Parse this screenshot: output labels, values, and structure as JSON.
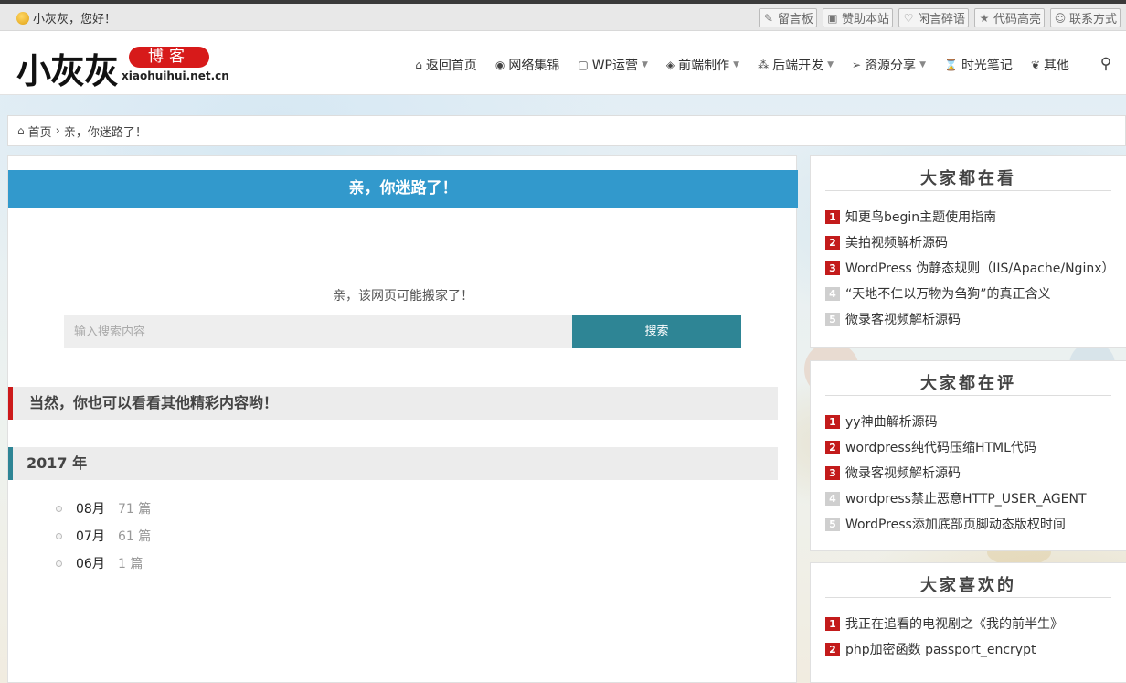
{
  "topbar": {
    "greeting": "小灰灰，您好！",
    "links": [
      {
        "icon": "edit-icon",
        "glyph": "✎",
        "label": "留言板"
      },
      {
        "icon": "donate-icon",
        "glyph": "▣",
        "label": "赞助本站"
      },
      {
        "icon": "heart-icon",
        "glyph": "♡",
        "label": "闲言碎语"
      },
      {
        "icon": "star-icon",
        "glyph": "★",
        "label": "代码高亮"
      },
      {
        "icon": "user-icon",
        "glyph": "☺",
        "label": "联系方式"
      }
    ]
  },
  "header": {
    "logo_text": "小灰灰",
    "logo_badge": "博客",
    "logo_url": "xiaohuihui.net.cn",
    "nav": [
      {
        "icon": "home-icon",
        "glyph": "⌂",
        "label": "返回首页",
        "dropdown": false
      },
      {
        "icon": "globe-icon",
        "glyph": "◉",
        "label": "网络集锦",
        "dropdown": false
      },
      {
        "icon": "chat-icon",
        "glyph": "▢",
        "label": "WP运营",
        "dropdown": true
      },
      {
        "icon": "html5-icon",
        "glyph": "◈",
        "label": "前端制作",
        "dropdown": true
      },
      {
        "icon": "cubes-icon",
        "glyph": "⁂",
        "label": "后端开发",
        "dropdown": true
      },
      {
        "icon": "send-icon",
        "glyph": "➢",
        "label": "资源分享",
        "dropdown": true
      },
      {
        "icon": "hourglass-icon",
        "glyph": "⌛",
        "label": "时光笔记",
        "dropdown": false
      },
      {
        "icon": "leaf-icon",
        "glyph": "❦",
        "label": "其他",
        "dropdown": false
      }
    ],
    "search_glyph": "⚲"
  },
  "breadcrumb": {
    "home": "首页",
    "separator": "›",
    "current": "亲，你迷路了！"
  },
  "main": {
    "banner": "亲，你迷路了！",
    "message": "亲，该网页可能搬家了！",
    "search_placeholder": "输入搜索内容",
    "search_button": "搜索",
    "suggest_heading": "当然，你也可以看看其他精彩内容哟！",
    "year_heading": "2017 年",
    "archives": [
      {
        "month": "08月",
        "count": "71 篇"
      },
      {
        "month": "07月",
        "count": "61 篇"
      },
      {
        "month": "06月",
        "count": "1 篇"
      }
    ]
  },
  "sidebar": [
    {
      "title": "大家都在看",
      "items": [
        {
          "rank": "1",
          "text": "知更鸟begin主题使用指南"
        },
        {
          "rank": "2",
          "text": "美拍视频解析源码"
        },
        {
          "rank": "3",
          "text": "WordPress 伪静态规则（IIS/Apache/Nginx）"
        },
        {
          "rank": "4",
          "text": "“天地不仁以万物为刍狗”的真正含义"
        },
        {
          "rank": "5",
          "text": "微录客视频解析源码"
        }
      ]
    },
    {
      "title": "大家都在评",
      "items": [
        {
          "rank": "1",
          "text": "yy神曲解析源码"
        },
        {
          "rank": "2",
          "text": "wordpress纯代码压缩HTML代码"
        },
        {
          "rank": "3",
          "text": "微录客视频解析源码"
        },
        {
          "rank": "4",
          "text": "wordpress禁止恶意HTTP_USER_AGENT"
        },
        {
          "rank": "5",
          "text": "WordPress添加底部页脚动态版权时间"
        }
      ]
    },
    {
      "title": "大家喜欢的",
      "items": [
        {
          "rank": "1",
          "text": "我正在追看的电视剧之《我的前半生》"
        },
        {
          "rank": "2",
          "text": "php加密函数 passport_encrypt"
        }
      ]
    }
  ],
  "colors": {
    "banner_blue": "#3299cc",
    "button_teal": "#2e8595",
    "rank_red": "#c31b1b",
    "logo_red": "#d71a1a"
  }
}
